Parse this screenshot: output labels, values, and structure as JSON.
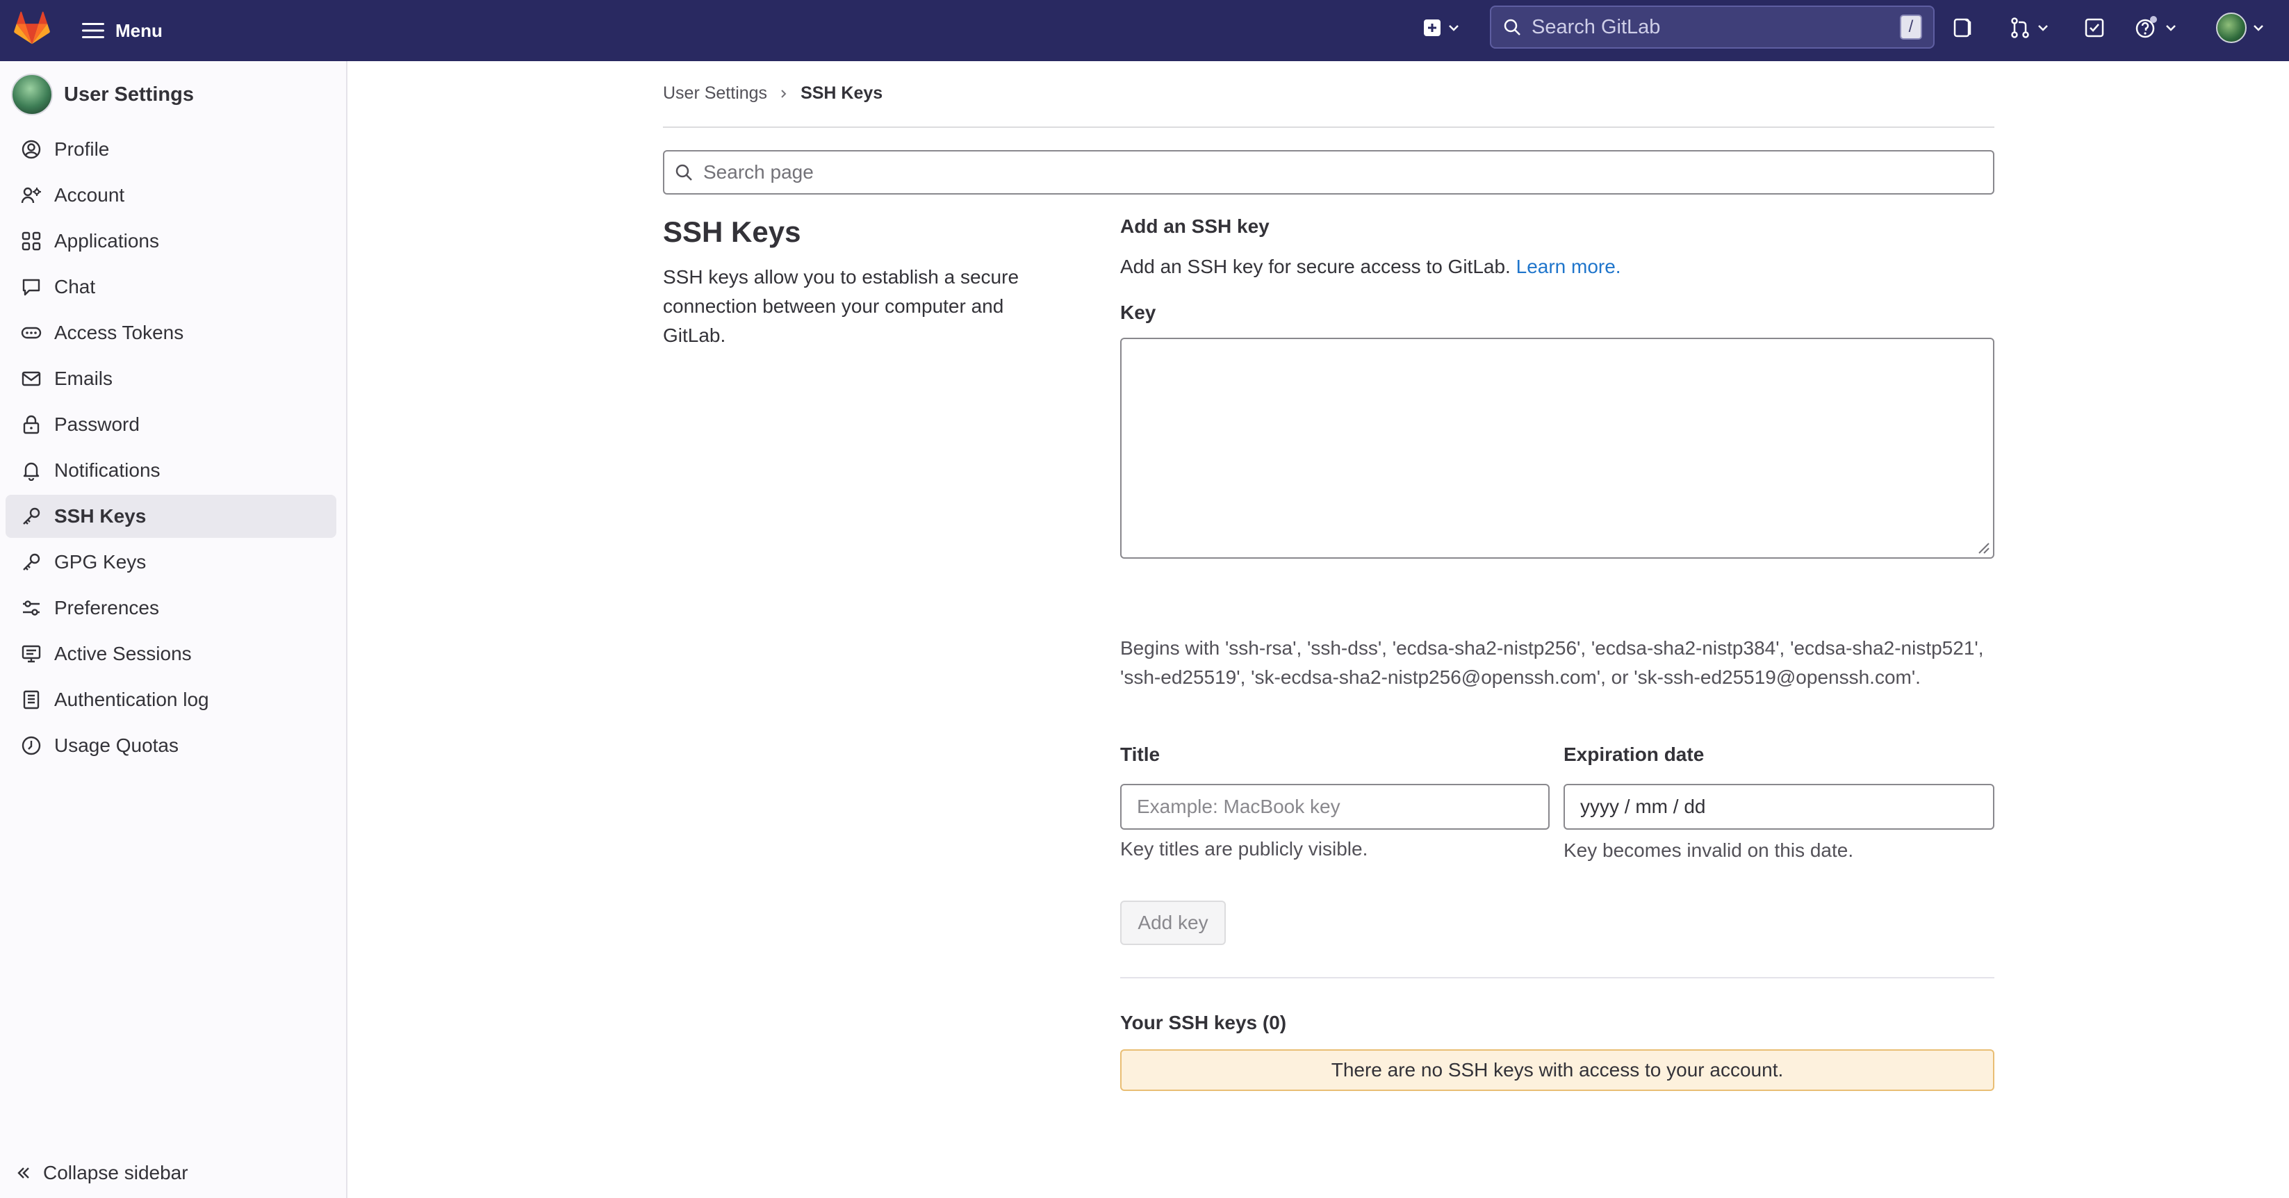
{
  "topbar": {
    "menu_label": "Menu",
    "search_placeholder": "Search GitLab",
    "search_shortcut": "/",
    "icons": [
      "gitlab-logo",
      "hamburger-icon",
      "plus-square-icon",
      "chevron-down-icon",
      "search-icon",
      "issues-icon",
      "merge-request-icon",
      "todo-icon",
      "help-icon",
      "user-avatar"
    ],
    "bg_color": "#292961"
  },
  "sidebar": {
    "title": "User Settings",
    "items": [
      {
        "label": "Profile",
        "icon": "profile-icon"
      },
      {
        "label": "Account",
        "icon": "account-icon"
      },
      {
        "label": "Applications",
        "icon": "applications-icon"
      },
      {
        "label": "Chat",
        "icon": "chat-icon"
      },
      {
        "label": "Access Tokens",
        "icon": "token-icon"
      },
      {
        "label": "Emails",
        "icon": "mail-icon"
      },
      {
        "label": "Password",
        "icon": "lock-icon"
      },
      {
        "label": "Notifications",
        "icon": "bell-icon"
      },
      {
        "label": "SSH Keys",
        "icon": "key-icon",
        "active": true
      },
      {
        "label": "GPG Keys",
        "icon": "key-icon"
      },
      {
        "label": "Preferences",
        "icon": "preferences-icon"
      },
      {
        "label": "Active Sessions",
        "icon": "monitor-icon"
      },
      {
        "label": "Authentication log",
        "icon": "log-icon"
      },
      {
        "label": "Usage Quotas",
        "icon": "quota-icon"
      }
    ],
    "collapse_label": "Collapse sidebar"
  },
  "breadcrumb": {
    "parent": "User Settings",
    "current": "SSH Keys"
  },
  "page_search": {
    "placeholder": "Search page"
  },
  "intro": {
    "title": "SSH Keys",
    "description": "SSH keys allow you to establish a secure connection between your computer and GitLab."
  },
  "add_key": {
    "heading": "Add an SSH key",
    "description": "Add an SSH key for secure access to GitLab.",
    "learn_more": "Learn more.",
    "key_label": "Key",
    "key_value": "",
    "key_hint": "Begins with 'ssh-rsa', 'ssh-dss', 'ecdsa-sha2-nistp256', 'ecdsa-sha2-nistp384', 'ecdsa-sha2-nistp521', 'ssh-ed25519', 'sk-ecdsa-sha2-nistp256@openssh.com', or 'sk-ssh-ed25519@openssh.com'.",
    "title_label": "Title",
    "title_placeholder": "Example: MacBook key",
    "title_help": "Key titles are publicly visible.",
    "expiration_label": "Expiration date",
    "expiration_value": "yyyy / mm / dd",
    "expiration_help": "Key becomes invalid on this date.",
    "button_label": "Add key"
  },
  "your_keys": {
    "heading": "Your SSH keys (0)",
    "empty_message": "There are no SSH keys with access to your account."
  }
}
